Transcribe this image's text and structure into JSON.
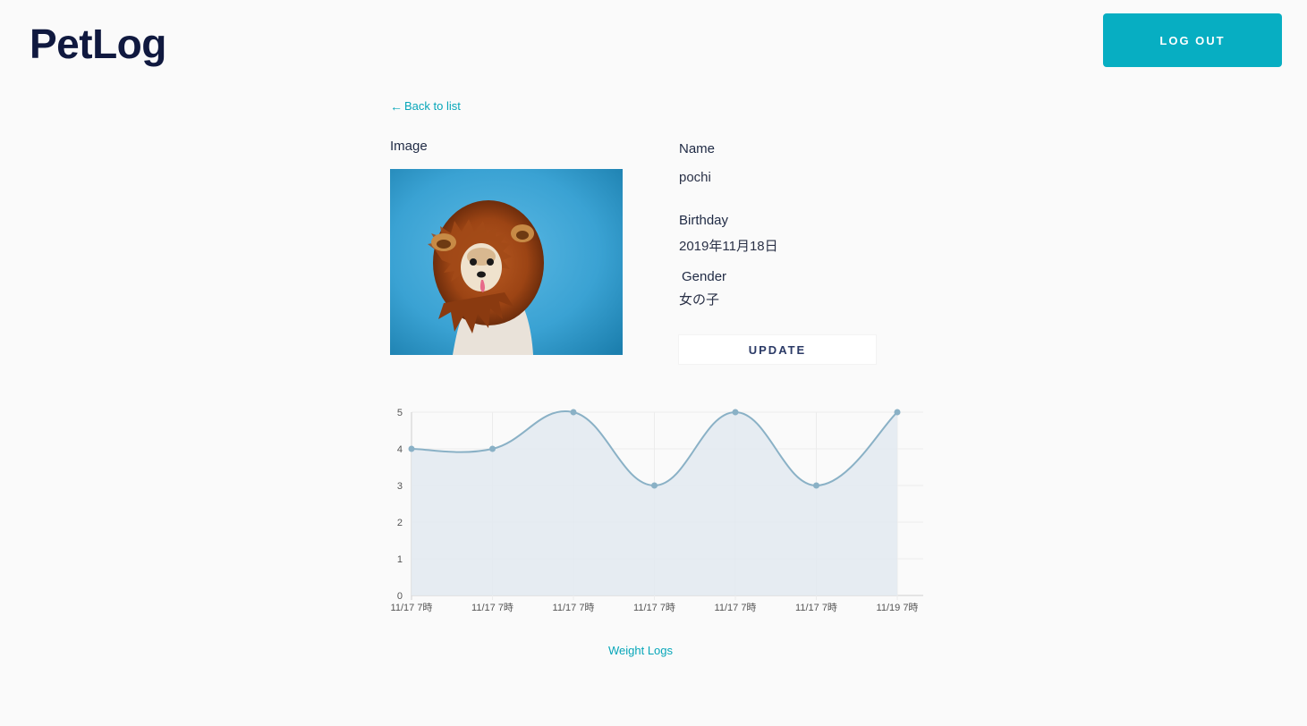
{
  "header": {
    "logo": "PetLog",
    "logout_label": "LOG OUT"
  },
  "nav": {
    "back_arrow": "←",
    "back_label": "Back to list"
  },
  "pet": {
    "image_label": "Image",
    "image_icon": "dog-in-lion-mane-photo",
    "name_label": "Name",
    "name": "pochi",
    "birthday_label": "Birthday",
    "birthday": "2019年11月18日",
    "gender_label": "Gender",
    "gender": "女の子",
    "update_label": "UPDATE"
  },
  "chart_data": {
    "type": "area",
    "categories": [
      "11/17 7時",
      "11/17 7時",
      "11/17 7時",
      "11/17 7時",
      "11/17 7時",
      "11/17 7時",
      "11/19 7時"
    ],
    "series": [
      {
        "values": [
          4,
          4,
          5,
          3,
          5,
          3,
          5
        ]
      }
    ],
    "yticks": [
      "0",
      "1",
      "2",
      "3",
      "4",
      "5"
    ],
    "ylim": [
      0,
      5
    ],
    "grid": true,
    "line_color": "#8ab1c6",
    "fill_color": "#e3eaf1",
    "caption": "Weight Logs"
  }
}
